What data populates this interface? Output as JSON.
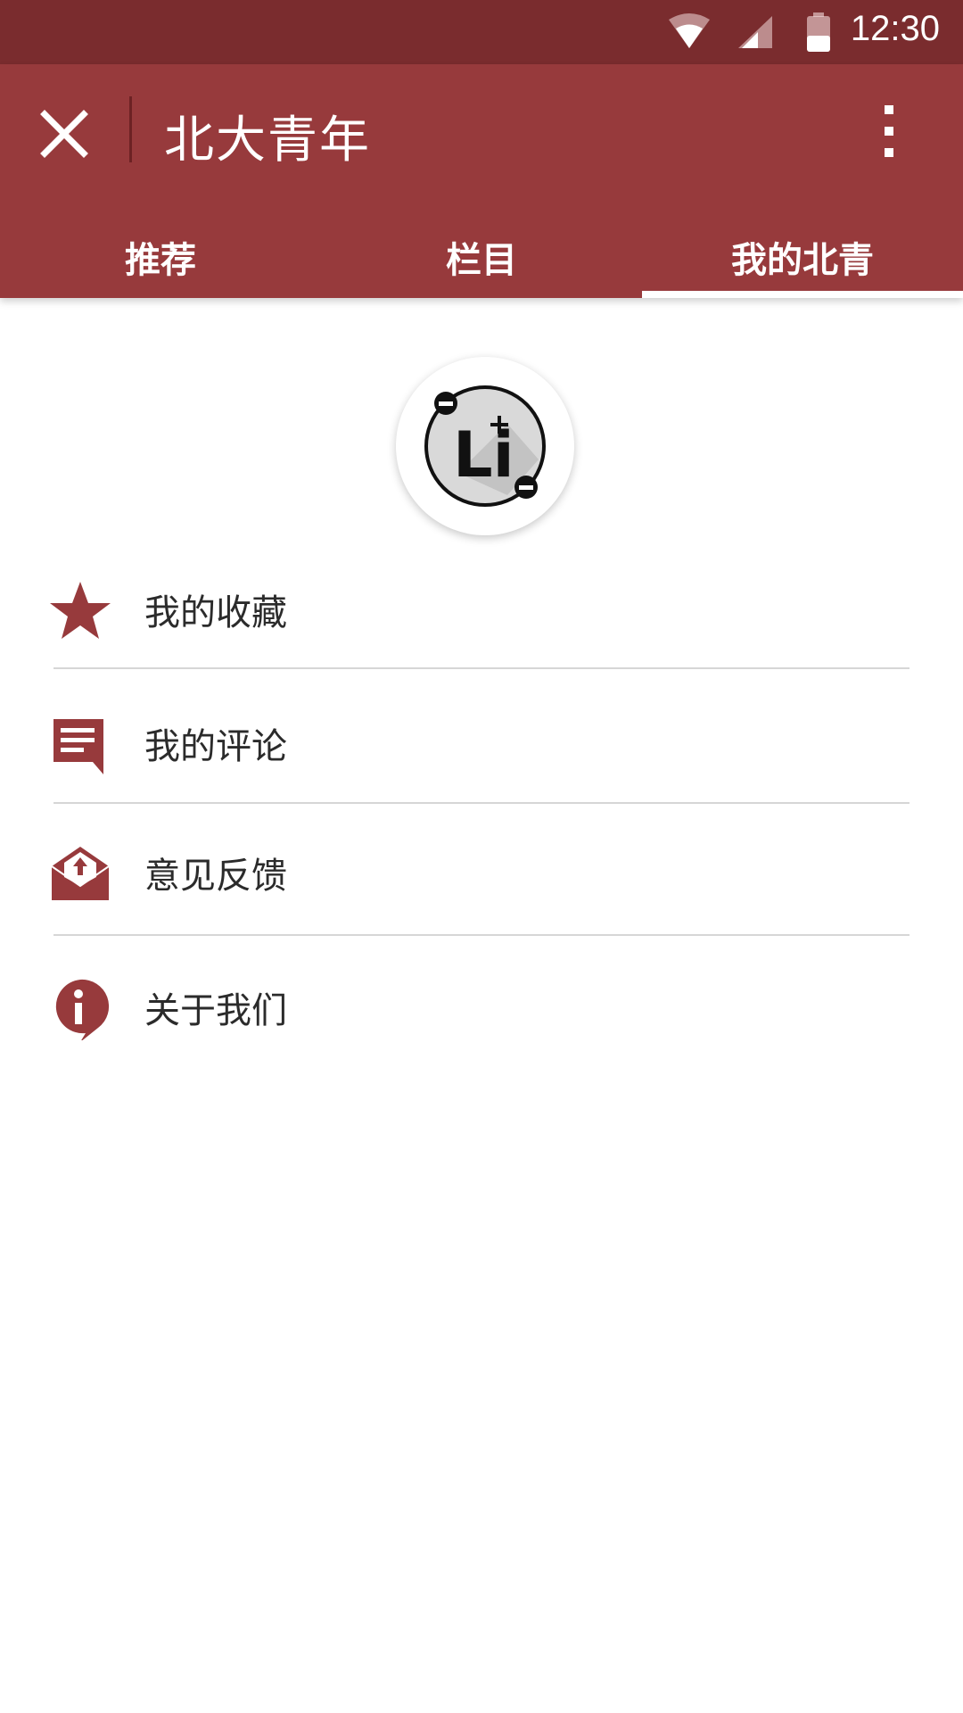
{
  "status_bar": {
    "time": "12:30",
    "icons": [
      "wifi-icon",
      "signal-icon",
      "battery-icon"
    ]
  },
  "app_bar": {
    "title": "北大青年",
    "close_icon": "close-icon",
    "more_icon": "more-vert-icon"
  },
  "tabs": [
    {
      "label": "推荐"
    },
    {
      "label": "栏目"
    },
    {
      "label": "我的北青",
      "selected": true
    }
  ],
  "avatar": {
    "logo_text": "Li"
  },
  "menu": [
    {
      "label": "我的收藏",
      "icon": "star-icon"
    },
    {
      "label": "我的评论",
      "icon": "comment-icon"
    },
    {
      "label": "意见反馈",
      "icon": "feedback-mail-icon"
    },
    {
      "label": "关于我们",
      "icon": "info-icon"
    }
  ],
  "colors": {
    "status_bar": "#7a2c2e",
    "app_bar": "#973a3c",
    "accent": "#973a3c",
    "text": "#2b2b2b",
    "divider": "#d6d6d6"
  }
}
